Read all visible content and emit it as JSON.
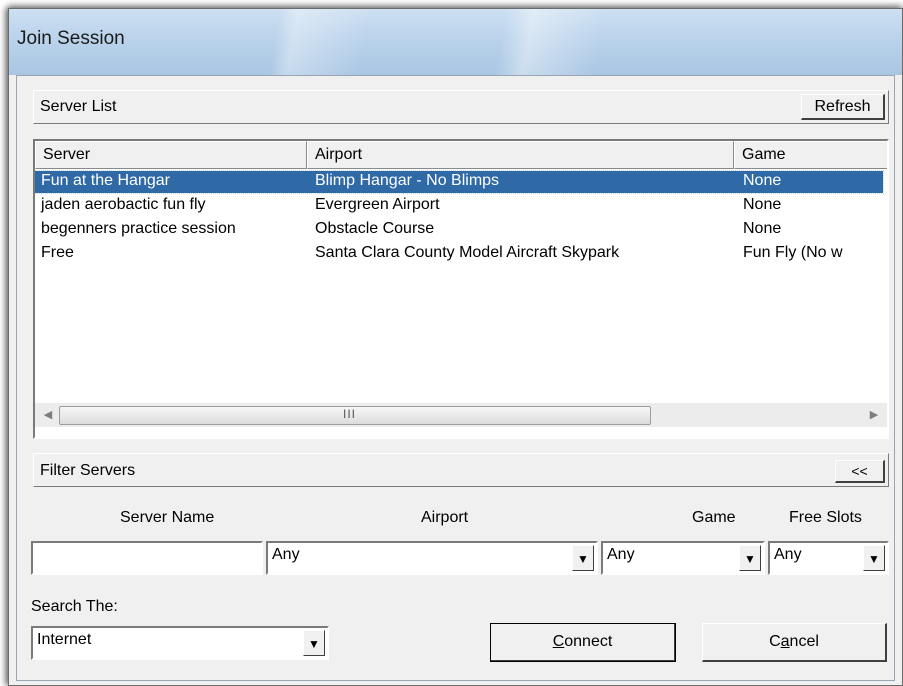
{
  "window": {
    "title": "Join Session"
  },
  "server_list": {
    "label": "Server List",
    "refresh_label": "Refresh",
    "columns": [
      "Server",
      "Airport",
      "Game"
    ],
    "rows": [
      {
        "server": "Fun at the Hangar",
        "airport": "Blimp Hangar - No Blimps",
        "game": "None",
        "selected": true
      },
      {
        "server": "jaden aerobactic fun fly",
        "airport": "Evergreen Airport",
        "game": "None",
        "selected": false
      },
      {
        "server": "begenners practice session",
        "airport": "Obstacle Course",
        "game": "None",
        "selected": false
      },
      {
        "server": "Free",
        "airport": "Santa Clara County Model Aircraft Skypark",
        "game": "Fun Fly (No w",
        "selected": false
      }
    ],
    "scrollbar": {
      "thumb_grip": "III"
    }
  },
  "filter": {
    "label": "Filter Servers",
    "collapse_label": "<<",
    "server_name_label": "Server Name",
    "airport_label": "Airport",
    "game_label": "Game",
    "free_slots_label": "Free Slots",
    "server_name_value": "",
    "airport_value": "Any",
    "game_value": "Any",
    "free_slots_value": "Any"
  },
  "search": {
    "label": "Search The:",
    "value": "Internet"
  },
  "buttons": {
    "connect_label_pre": "",
    "connect_label_key": "C",
    "connect_label_post": "onnect",
    "cancel_label_pre": "C",
    "cancel_label_key": "a",
    "cancel_label_post": "ncel"
  },
  "icons": {
    "dropdown": "chevron-down-icon",
    "scroll_left": "arrow-left-icon",
    "scroll_right": "arrow-right-icon"
  }
}
